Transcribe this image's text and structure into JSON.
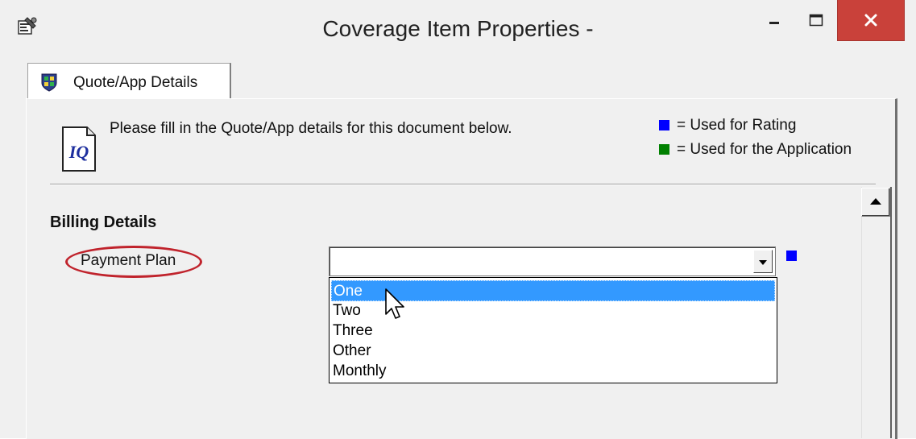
{
  "window": {
    "title": "Coverage Item Properties -",
    "app_icon": "properties-icon",
    "controls": {
      "minimize": "minimize-icon",
      "maximize": "maximize-icon",
      "close": "close-icon"
    }
  },
  "tabs": [
    {
      "label": "Quote/App Details",
      "icon": "shield-icon",
      "active": true
    }
  ],
  "header": {
    "doc_icon": "IQ",
    "instruction": "Please fill in the Quote/App details for this document below."
  },
  "legend": [
    {
      "color": "#0000ff",
      "label": "= Used for Rating"
    },
    {
      "color": "#008000",
      "label": "= Used for the Application"
    }
  ],
  "section": {
    "heading": "Billing Details"
  },
  "field": {
    "label": "Payment Plan",
    "value": "",
    "marker_color": "#0000ff",
    "options": [
      "One",
      "Two",
      "Three",
      "Other",
      "Monthly"
    ],
    "highlighted_option": "One"
  },
  "colors": {
    "highlight": "#3399ff",
    "annotation": "#c0232c",
    "close_button": "#c9413a"
  }
}
